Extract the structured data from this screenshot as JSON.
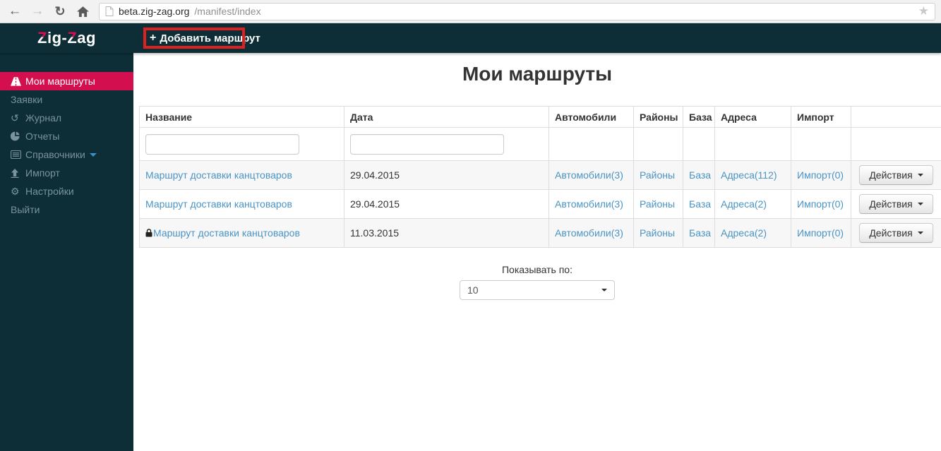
{
  "browser": {
    "back_glyph": "←",
    "forward_glyph": "→",
    "reload_glyph": "↻",
    "url_host": "beta.zig-zag.org",
    "url_path": "/manifest/index",
    "star_glyph": "★"
  },
  "header": {
    "logo_z1": "Z",
    "logo_r1": "ig-",
    "logo_z2": "Z",
    "logo_r2": "ag",
    "add_plus": "+",
    "add_label": "Добавить маршрут"
  },
  "sidebar": {
    "items": [
      {
        "label": "Мои маршруты",
        "icon": "road-icon",
        "active": true
      },
      {
        "label": "Заявки"
      },
      {
        "label": "Журнал",
        "icon": "history-icon",
        "glyph": "↺"
      },
      {
        "label": "Отчеты",
        "icon": "pie-chart-icon"
      },
      {
        "label": "Справочники",
        "icon": "list-icon",
        "has_caret": true
      },
      {
        "label": "Импорт",
        "icon": "upload-icon"
      },
      {
        "label": "Настройки",
        "icon": "gear-icon",
        "glyph": "⚙"
      },
      {
        "label": "Выйти"
      }
    ]
  },
  "main": {
    "title": "Мои маршруты",
    "table": {
      "headers": {
        "name": "Название",
        "date": "Дата",
        "cars": "Автомобили",
        "districts": "Районы",
        "base": "База",
        "addresses": "Адреса",
        "import": "Импорт"
      },
      "rows": [
        {
          "name": "Маршрут доставки канцтоваров",
          "locked": false,
          "date": "29.04.2015",
          "cars": "Автомобили(3)",
          "districts": "Районы",
          "base": "База",
          "addresses": "Адреса(112)",
          "import": "Импорт(0)",
          "actions": "Действия"
        },
        {
          "name": "Маршрут доставки канцтоваров",
          "locked": false,
          "date": "29.04.2015",
          "cars": "Автомобили(3)",
          "districts": "Районы",
          "base": "База",
          "addresses": "Адреса(2)",
          "import": "Импорт(0)",
          "actions": "Действия"
        },
        {
          "name": "Маршрут доставки канцтоваров",
          "locked": true,
          "date": "11.03.2015",
          "cars": "Автомобили(3)",
          "districts": "Районы",
          "base": "База",
          "addresses": "Адреса(2)",
          "import": "Импорт(0)",
          "actions": "Действия"
        }
      ]
    },
    "pagination": {
      "label": "Показывать по:",
      "page_size": "10"
    }
  },
  "colors": {
    "topbar_teal": "#0d2e36",
    "accent_crimson": "#d30f4f",
    "link_blue": "#4a94c5",
    "annotation_red": "#dd2121"
  }
}
